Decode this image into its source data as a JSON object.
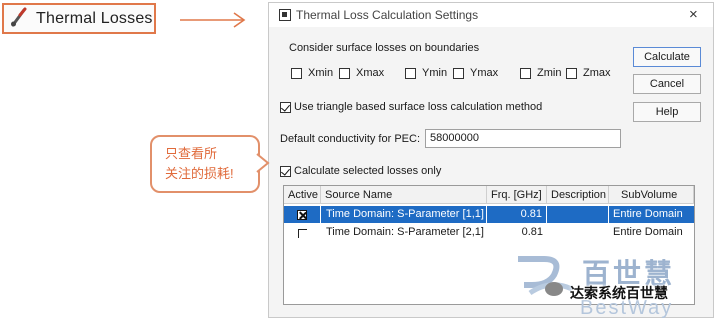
{
  "ribbon": {
    "label": "Thermal Losses",
    "icon": "thermometer-brush-icon"
  },
  "dialog": {
    "title": "Thermal Loss Calculation Settings",
    "close_glyph": "×",
    "boundaries": {
      "label": "Consider surface losses on boundaries",
      "items": [
        {
          "label": "Xmin",
          "checked": false
        },
        {
          "label": "Xmax",
          "checked": false
        },
        {
          "label": "Ymin",
          "checked": false
        },
        {
          "label": "Ymax",
          "checked": false
        },
        {
          "label": "Zmin",
          "checked": false
        },
        {
          "label": "Zmax",
          "checked": false
        }
      ]
    },
    "triangle_method": {
      "label": "Use triangle based surface loss calculation method",
      "checked": true
    },
    "pec": {
      "label": "Default conductivity for PEC:",
      "value": "58000000"
    },
    "selected_only": {
      "label": "Calculate selected losses only",
      "checked": true
    },
    "buttons": {
      "calculate": "Calculate",
      "cancel": "Cancel",
      "help": "Help"
    },
    "table": {
      "columns": [
        "Active",
        "Source Name",
        "Frq. [GHz]",
        "Description",
        "SubVolume"
      ],
      "rows": [
        {
          "active": true,
          "source": "Time Domain: S-Parameter [1,1]",
          "freq": "0.81",
          "description": "",
          "subvolume": "Entire Domain",
          "selected": true
        },
        {
          "active": false,
          "source": "Time Domain: S-Parameter [2,1]",
          "freq": "0.81",
          "description": "",
          "subvolume": "Entire Domain",
          "selected": false
        }
      ]
    }
  },
  "callout": {
    "line1": "只查看所",
    "line2": "关注的损耗!"
  },
  "watermark": {
    "big": "百世慧",
    "english": "BestWay",
    "wechat": "达索系统百世慧"
  },
  "colors": {
    "accent": "#e0784a",
    "selection": "#1e6bc4"
  }
}
